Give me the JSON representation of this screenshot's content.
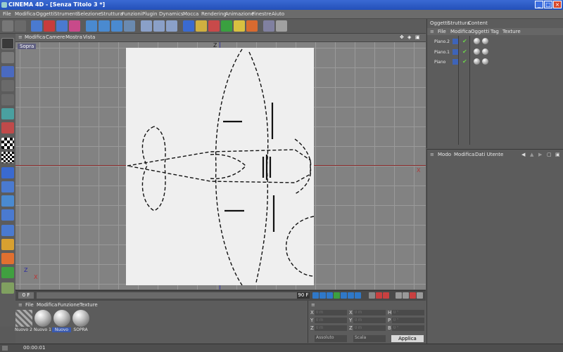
{
  "window": {
    "title": "CINEMA 4D - [Senza Titolo 3 *]"
  },
  "main_menu": [
    "File",
    "Modifica",
    "Oggetti",
    "Strumenti",
    "Selezione",
    "Struttura",
    "Funzioni",
    "Plugin",
    "Dynamics",
    "Mocca",
    "Rendering",
    "Animazione",
    "Finestre",
    "Aiuto"
  ],
  "viewport": {
    "menu": [
      "Modifica",
      "Camere",
      "Mostra",
      "Vista"
    ],
    "label": "Sopra",
    "axis_z": "Z",
    "axis_x": "X"
  },
  "timeline": {
    "start": "0 F",
    "end": "90 F"
  },
  "material_manager": {
    "menu": [
      "File",
      "Modifica",
      "Funzione",
      "Texture"
    ],
    "materials": [
      "Nuovo 2",
      "Nuovo 1",
      "Nuovo",
      "SOPRA"
    ]
  },
  "coordinates": {
    "labels": [
      "X",
      "Y",
      "Z",
      "X",
      "Y",
      "Z",
      "H",
      "P",
      "B"
    ],
    "placeholders": [
      "0 m",
      "0 m",
      "0 m",
      "0 m",
      "0 m",
      "0 m",
      "0 °",
      "0 °",
      "0 °"
    ],
    "mode_select": "Assoluto",
    "size_select": "Scala",
    "apply": "Applica"
  },
  "object_manager": {
    "tabs": [
      "Oggetti",
      "Struttura",
      "Content"
    ],
    "menu": [
      "File",
      "Modifica",
      "Oggetti",
      "Tag",
      "Texture"
    ],
    "objects": [
      "Piano.2",
      "Piano.1",
      "Piano"
    ]
  },
  "attribute_manager": {
    "menu": [
      "Modo",
      "Modifica",
      "Dati Utente"
    ]
  },
  "status": {
    "time": "00:00:01"
  }
}
